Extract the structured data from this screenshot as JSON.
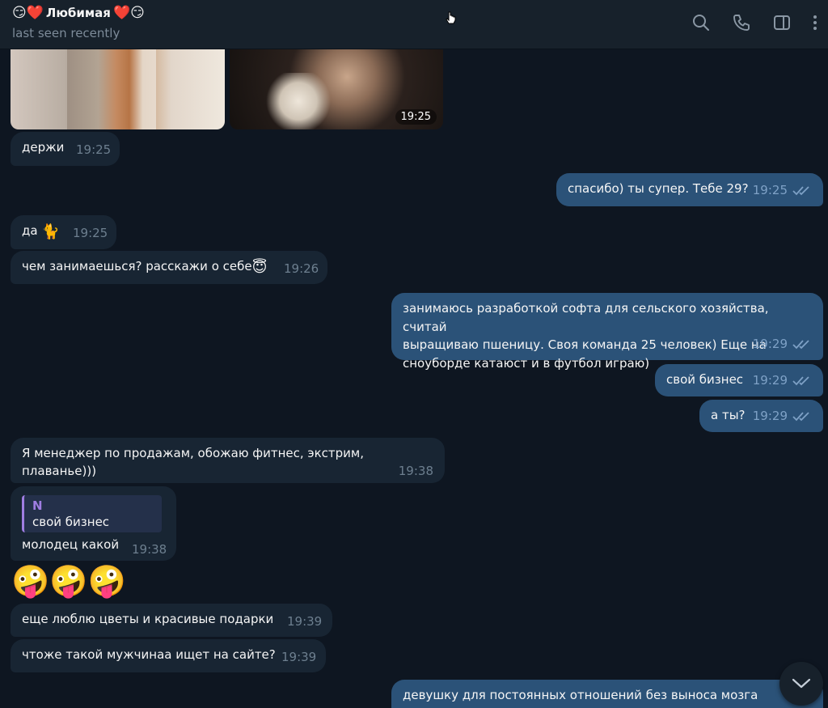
{
  "header": {
    "title_prefix_emoji": "😏❤️",
    "title": "Любимая",
    "title_suffix_emoji": "❤️😏",
    "status": "last seen recently",
    "icons": [
      "search-icon",
      "phone-icon",
      "sidebar-toggle-icon",
      "more-icon"
    ]
  },
  "media": {
    "time": "19:25"
  },
  "messages": [
    {
      "id": "m1",
      "dir": "in",
      "text": "держи",
      "time": "19:25"
    },
    {
      "id": "m2",
      "dir": "out",
      "text": "спасибо) ты супер. Тебе 29?",
      "time": "19:25",
      "read": true
    },
    {
      "id": "m3",
      "dir": "in",
      "text": "да",
      "emoji": "🐈",
      "time": "19:25"
    },
    {
      "id": "m4",
      "dir": "in",
      "text": "чем занимаешься? расскажи о себе",
      "emoji": "😇",
      "time": "19:26"
    },
    {
      "id": "m5",
      "dir": "out",
      "lines": [
        "занимаюсь разработкой софта для сельского хозяйства, считай",
        "выращиваю пшеницу. Своя команда 25 человек) Еще на",
        "сноуборде катаюст и в футбол играю)"
      ],
      "time": "19:29",
      "read": true
    },
    {
      "id": "m6",
      "dir": "out",
      "text": "свой бизнес",
      "time": "19:29",
      "read": true
    },
    {
      "id": "m7",
      "dir": "out",
      "text": "а ты?",
      "time": "19:29",
      "read": true
    },
    {
      "id": "m8",
      "dir": "in",
      "text": "Я менеджер по продажам, обожаю фитнес, экстрим, плаванье)))",
      "time": "19:38"
    },
    {
      "id": "m9",
      "dir": "in",
      "reply_name": "N",
      "reply_text": "свой бизнес",
      "text": "молодец какой",
      "time": "19:38"
    },
    {
      "id": "m10",
      "dir": "in",
      "sticker": "🤪🤪🤪"
    },
    {
      "id": "m11",
      "dir": "in",
      "text": "еще люблю цветы и красивые подарки",
      "time": "19:39"
    },
    {
      "id": "m12",
      "dir": "in",
      "text": "чтоже такой мужчинаа ищет на сайте?",
      "time": "19:39"
    },
    {
      "id": "m13",
      "dir": "out",
      "text": "девушку для постоянных отношений без выноса мозга"
    }
  ],
  "colors": {
    "background": "#0e1621",
    "header": "#17212b",
    "incoming_bubble": "#182533",
    "outgoing_bubble": "#2b5278",
    "reply_accent": "#9f7de1",
    "read_check": "#7ea1c6"
  }
}
